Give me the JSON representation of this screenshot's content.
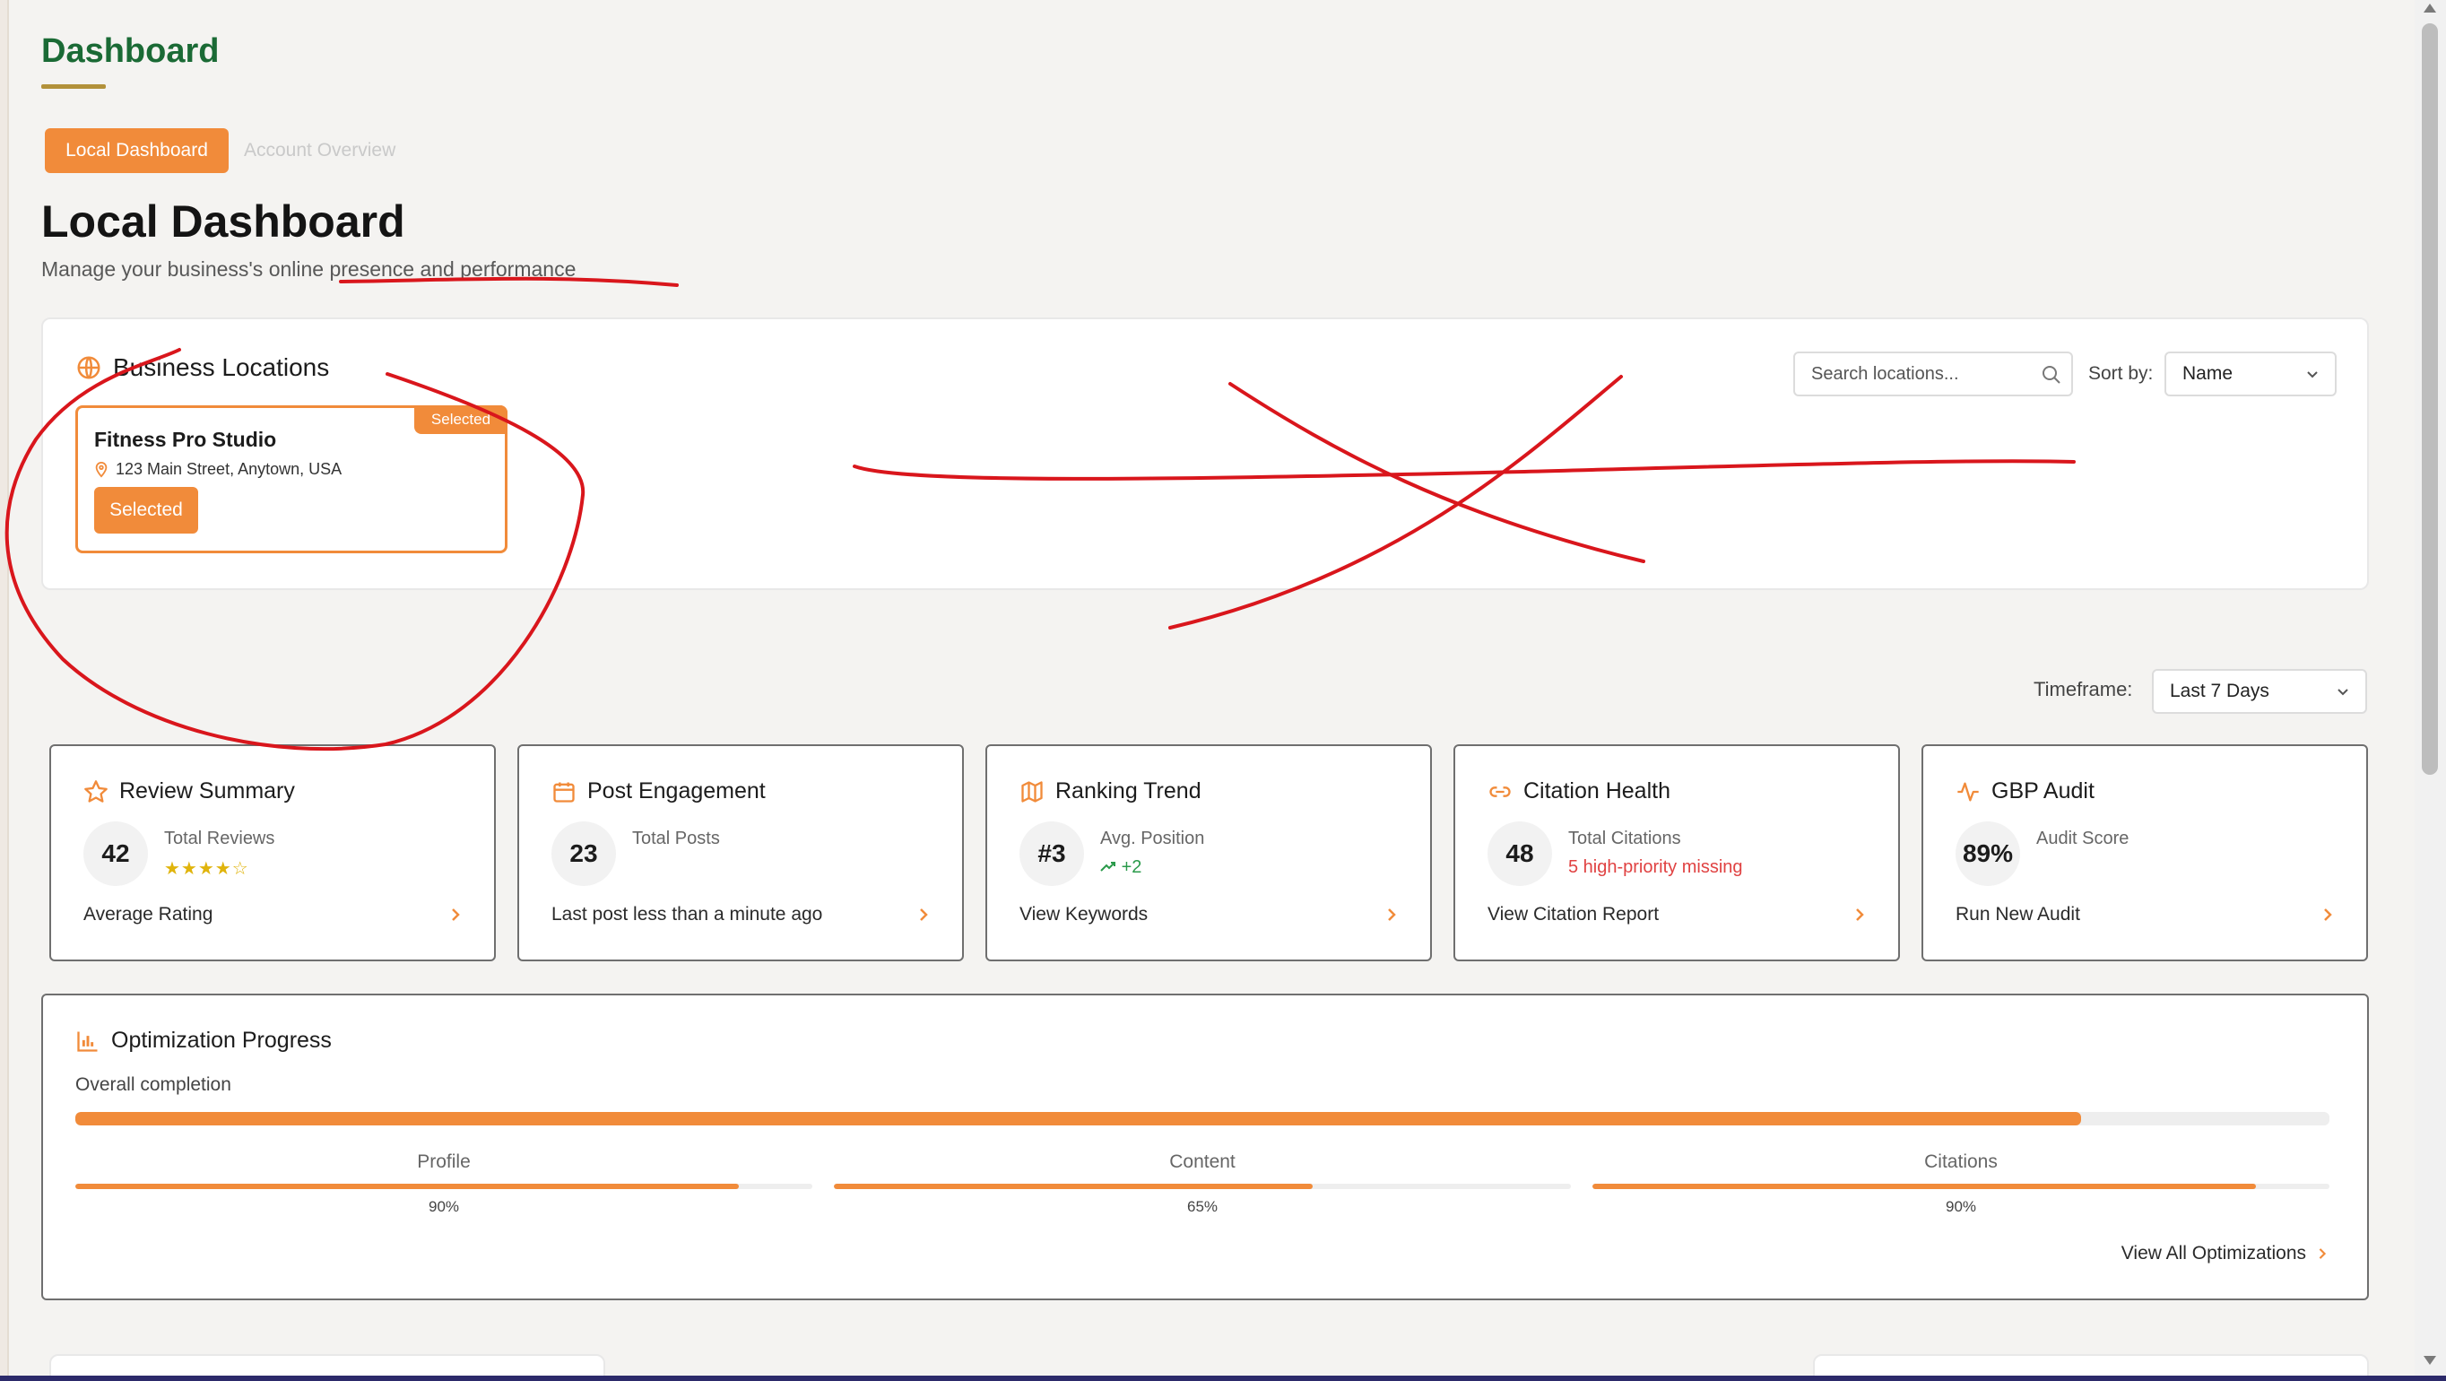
{
  "brand": {
    "title": "Dashboard"
  },
  "tabs": [
    {
      "label": "Local Dashboard",
      "active": true
    },
    {
      "label": "Account Overview",
      "active": false
    }
  ],
  "page": {
    "title": "Local Dashboard",
    "subtitle": "Manage your business's online presence and performance"
  },
  "locations": {
    "title": "Business Locations",
    "search_placeholder": "Search locations...",
    "sort_label": "Sort by:",
    "sort_value": "Name",
    "items": [
      {
        "name": "Fitness Pro Studio",
        "address": "123 Main Street, Anytown, USA",
        "badge": "Selected",
        "button": "Selected"
      }
    ]
  },
  "timeframe": {
    "label": "Timeframe:",
    "value": "Last 7 Days"
  },
  "metrics": [
    {
      "title": "Review Summary",
      "value": "42",
      "label": "Total Reviews",
      "stars": "★★★★☆",
      "footer": "Average Rating",
      "icon": "star-icon"
    },
    {
      "title": "Post Engagement",
      "value": "23",
      "label": "Total Posts",
      "footer": "Last post less than a minute ago",
      "icon": "calendar-icon"
    },
    {
      "title": "Ranking Trend",
      "value": "#3",
      "label": "Avg. Position",
      "trend": "+2",
      "footer": "View Keywords",
      "icon": "map-icon"
    },
    {
      "title": "Citation Health",
      "value": "48",
      "label": "Total Citations",
      "alert": "5 high-priority missing",
      "footer": "View Citation Report",
      "icon": "link-icon"
    },
    {
      "title": "GBP Audit",
      "value": "89%",
      "label": "Audit Score",
      "footer": "Run New Audit",
      "icon": "activity-icon"
    }
  ],
  "optimization": {
    "title": "Optimization Progress",
    "overall_label": "Overall completion",
    "overall": 0.89,
    "parts": [
      {
        "label": "Profile",
        "pct_text": "90%",
        "value": 0.9
      },
      {
        "label": "Content",
        "pct_text": "65%",
        "value": 0.65
      },
      {
        "label": "Citations",
        "pct_text": "90%",
        "value": 0.9
      }
    ],
    "link": "View All Optimizations"
  },
  "colors": {
    "accent": "#f18b3a",
    "brand": "#1a6a35",
    "annotation": "#d9161c"
  }
}
